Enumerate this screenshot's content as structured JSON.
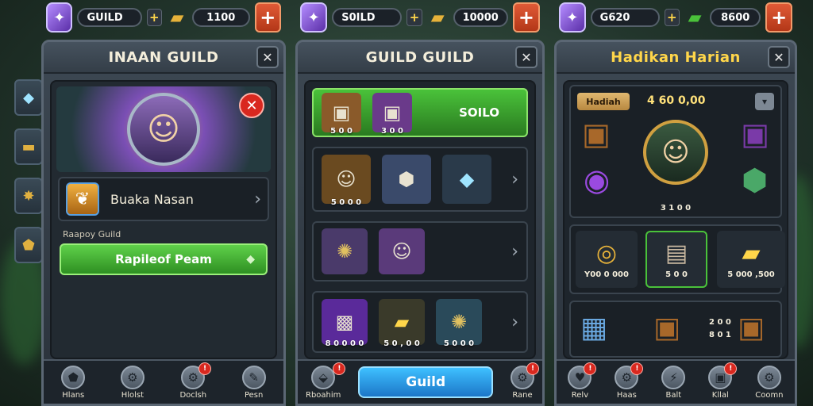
{
  "colors": {
    "accent_green": "#4ac23a",
    "accent_blue": "#1c76c8",
    "accent_red": "#d9281f",
    "gold": "#ffd64a",
    "gem_purple": "#7b4fb5"
  },
  "side_icons": [
    "crystal-icon",
    "chest-icon",
    "sword-icon",
    "shield-icon"
  ],
  "panel1": {
    "resources": {
      "gem_value": "GUILD",
      "gold_value": "1100"
    },
    "title": "INAAN GUILD",
    "guild_name": "Buaka Nasan",
    "guild_label": "Raapoy Guild",
    "green_button": "Rapileof Peam",
    "nav": [
      {
        "icon": "shield-icon",
        "label": "Hlans"
      },
      {
        "icon": "gear-icon",
        "label": "Hlolst"
      },
      {
        "icon": "gear-icon",
        "label": "Doclsh"
      },
      {
        "icon": "wrench-icon",
        "label": "Pesn"
      }
    ]
  },
  "panel2": {
    "resources": {
      "gem_value": "S0ILD",
      "gold_value": "10000"
    },
    "title": "GUILD GUILD",
    "strip_label": "SOILO",
    "items": {
      "row1": [
        "5 0 0",
        "3 0 0"
      ],
      "row2": [
        "5 0 0 0"
      ],
      "row4": [
        "8 0 0 0 0",
        "5 0 , 0 0",
        "5 0 0 0"
      ]
    },
    "guild_button": "Guild",
    "nav": [
      {
        "icon": "boot-icon",
        "label": "Rboahim"
      },
      {
        "icon": "gear-icon",
        "label": "Rane"
      }
    ]
  },
  "panel3": {
    "resources": {
      "gem_value": "G620",
      "gold_value": "8600"
    },
    "title": "Hadikan Harian",
    "tag": "Hadiah",
    "gold_amount": "4 60 0,00",
    "portrait_caption": "3 1 0 0",
    "rewards": [
      "Y00 0 000",
      "5 0 0",
      "5 000 ,500"
    ],
    "chest_values": [
      "2 0 0",
      "8 0 1"
    ],
    "nav": [
      {
        "icon": "heart-icon",
        "label": "Relv"
      },
      {
        "icon": "gear-icon",
        "label": "Haas"
      },
      {
        "icon": "bolt-icon",
        "label": "Balt"
      },
      {
        "icon": "box-icon",
        "label": "Kllal"
      },
      {
        "icon": "gear-icon",
        "label": "Coomn"
      }
    ]
  }
}
